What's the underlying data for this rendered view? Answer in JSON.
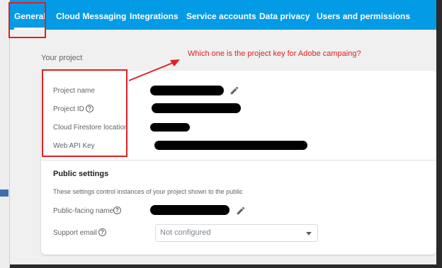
{
  "tabs": [
    {
      "label": "General"
    },
    {
      "label": "Cloud Messaging"
    },
    {
      "label": "Integrations"
    },
    {
      "label": "Service accounts"
    },
    {
      "label": "Data privacy"
    },
    {
      "label": "Users and permissions"
    }
  ],
  "your_project": {
    "title": "Your project",
    "fields": [
      {
        "label": "Project name"
      },
      {
        "label": "Project ID"
      },
      {
        "label": "Cloud Firestore location"
      },
      {
        "label": "Web API Key"
      }
    ]
  },
  "public_settings": {
    "title": "Public settings",
    "description": "These settings control instances of your project shown to the public",
    "public_facing_name_label": "Public-facing name",
    "support_email_label": "Support email",
    "support_email_value": "Not configured"
  },
  "annotation": {
    "text": "Which one is the project key for Adobe campaing?",
    "color": "#e02020"
  },
  "colors": {
    "tab_bar": "#039be5",
    "card": "#ffffff",
    "page_bg": "#f0f0f0"
  }
}
